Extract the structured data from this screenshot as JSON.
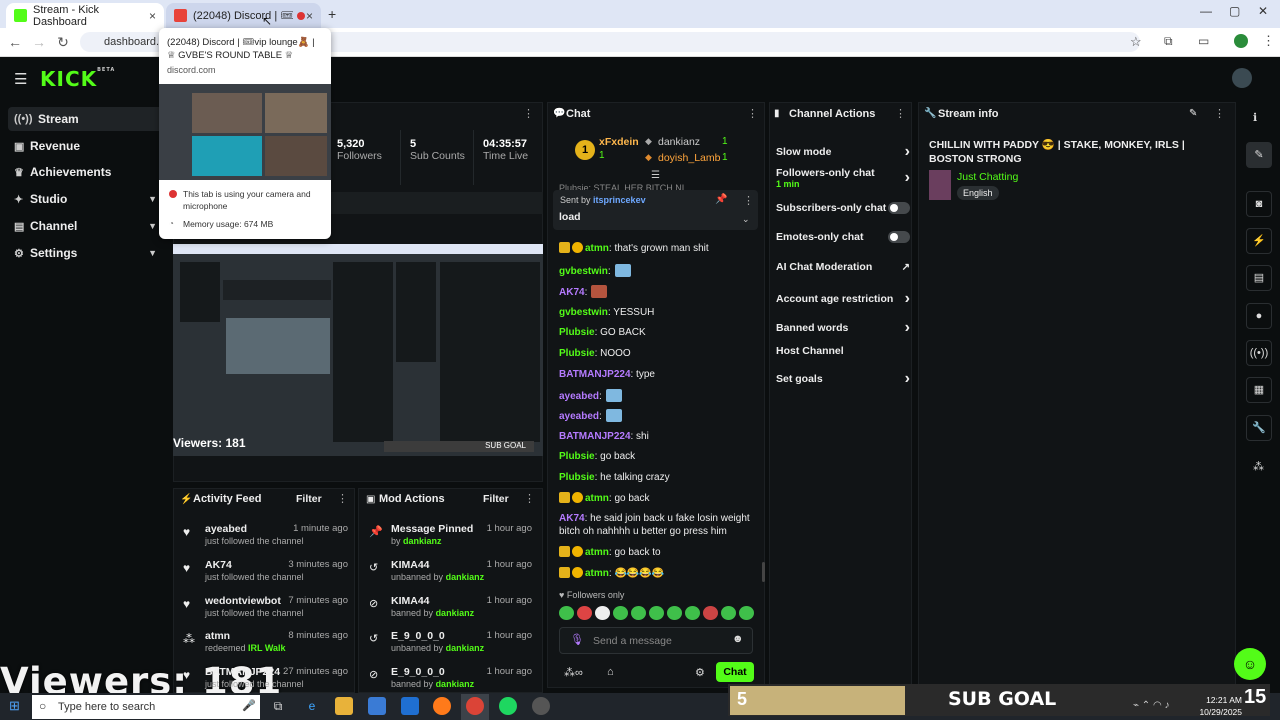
{
  "browser": {
    "tabs": [
      {
        "label": "Stream - Kick Dashboard",
        "close": "×"
      },
      {
        "label": "(22048) Discord | 🎟vip lou",
        "close": "×"
      }
    ],
    "new_tab": "+",
    "url": "dashboard.kick.com",
    "window_controls": [
      "—",
      "▢",
      "✕"
    ]
  },
  "tooltip": {
    "title": "(22048) Discord | 🎟vip lounge🧸 | ♕ GVBE'S ROUND TABLE ♕",
    "domain": "discord.com",
    "camera_note": "This tab is using your camera and microphone",
    "memory": "Memory usage: 674 MB"
  },
  "sidebar": {
    "items": [
      {
        "label": "Stream",
        "icon": "stream-icon"
      },
      {
        "label": "Revenue",
        "icon": "revenue-icon"
      },
      {
        "label": "Achievements",
        "icon": "trophy-icon"
      },
      {
        "label": "Studio",
        "icon": "studio-icon"
      },
      {
        "label": "Channel",
        "icon": "channel-icon"
      },
      {
        "label": "Settings",
        "icon": "gear-icon"
      }
    ]
  },
  "stats": [
    {
      "value": "5,320",
      "label": "Followers"
    },
    {
      "value": "5",
      "label": "Sub Counts"
    },
    {
      "value": "04:35:57",
      "label": "Time Live"
    }
  ],
  "video": {
    "viewers": "Viewers: 181",
    "sub_goal_small": "SUB GOAL"
  },
  "overlay": {
    "viewers": "Viewers: 181",
    "sub_goal_count": "5",
    "sub_goal_label": "SUB GOAL"
  },
  "chat": {
    "title": "Chat",
    "gifters": [
      {
        "rank": "1",
        "name": "xFxdein",
        "count": "1"
      },
      {
        "rank": "",
        "name": "dankianz",
        "count": "1"
      },
      {
        "rank": "",
        "name": "doyish_Lamb",
        "count": "1"
      }
    ],
    "pinned_behind": "Plubsie: STEAL HER BITCH NI",
    "pinned": {
      "sent_by_label": "Sent by",
      "sent_by": "itsprincekev",
      "text": "load"
    },
    "messages": [
      {
        "user": "atmn",
        "color": "g",
        "text": ": that's grown man shit",
        "badges": 2
      },
      {
        "user": "gvbestwin",
        "color": "g",
        "text": ":",
        "emote": true
      },
      {
        "user": "AK74",
        "color": "p",
        "text": ":",
        "emote": true
      },
      {
        "user": "gvbestwin",
        "color": "g",
        "text": ": YESSUH"
      },
      {
        "user": "Plubsie",
        "color": "g",
        "text": ": GO BACK"
      },
      {
        "user": "Plubsie",
        "color": "g",
        "text": ": NOOO"
      },
      {
        "user": "BATMANJP224",
        "color": "p",
        "text": ": type"
      },
      {
        "user": "ayeabed",
        "color": "p",
        "text": ":",
        "emote": true
      },
      {
        "user": "ayeabed",
        "color": "p",
        "text": ":",
        "emote": true
      },
      {
        "user": "BATMANJP224",
        "color": "p",
        "text": ": shi"
      },
      {
        "user": "Plubsie",
        "color": "g",
        "text": ": go back"
      },
      {
        "user": "Plubsie",
        "color": "g",
        "text": ": he talking crazy"
      },
      {
        "user": "atmn",
        "color": "g",
        "text": ": go back",
        "badges": 2
      },
      {
        "user": "AK74",
        "color": "p",
        "text": ": he said join back u fake losin weight bitch oh nahhhh u better go press him"
      },
      {
        "user": "atmn",
        "color": "g",
        "text": ": go back to",
        "badges": 2
      },
      {
        "user": "atmn",
        "color": "g",
        "text": ": 😂😂😂😂",
        "badges": 2
      }
    ],
    "followers_only": "Followers only",
    "placeholder": "Send a message",
    "send_label": "Chat"
  },
  "channel_actions": {
    "title": "Channel Actions",
    "items": [
      {
        "label": "Slow mode"
      },
      {
        "label": "Followers-only chat",
        "sub": "1 min"
      },
      {
        "label": "Subscribers-only chat"
      },
      {
        "label": "Emotes-only chat"
      },
      {
        "label": "AI Chat Moderation"
      },
      {
        "label": "Account age restriction"
      },
      {
        "label": "Banned words"
      },
      {
        "label": "Host Channel"
      },
      {
        "label": "Set goals"
      }
    ]
  },
  "stream_info": {
    "title": "Stream info",
    "stream_title": "CHILLIN WITH PADDY 😎 | STAKE, MONKEY, IRLS | BOSTON STRONG",
    "category": "Just Chatting",
    "language": "English"
  },
  "activity_feed": {
    "title": "Activity Feed",
    "filter": "Filter",
    "items": [
      {
        "user": "ayeabed",
        "time": "1 minute ago",
        "desc": "just followed the channel",
        "icon": "heart-icon"
      },
      {
        "user": "AK74",
        "time": "3 minutes ago",
        "desc": "just followed the channel",
        "icon": "heart-icon"
      },
      {
        "user": "wedontviewbot",
        "time": "7 minutes ago",
        "desc": "just followed the channel",
        "icon": "heart-icon"
      },
      {
        "user": "atmn",
        "time": "8 minutes ago",
        "desc": "redeemed",
        "extra": "IRL Walk",
        "icon": "redeem-icon"
      },
      {
        "user": "BATMANJP224",
        "time": "27 minutes ago",
        "desc": "just followed the channel",
        "icon": "heart-icon"
      }
    ]
  },
  "mod_actions": {
    "title": "Mod Actions",
    "filter": "Filter",
    "items": [
      {
        "title": "Message Pinned",
        "time": "1 hour ago",
        "desc": "by",
        "by": "dankianz",
        "icon": "pin-icon"
      },
      {
        "title": "KIMA44",
        "time": "1 hour ago",
        "desc": "unbanned by",
        "by": "dankianz",
        "icon": "unban-icon"
      },
      {
        "title": "KIMA44",
        "time": "1 hour ago",
        "desc": "banned by",
        "by": "dankianz",
        "icon": "ban-icon"
      },
      {
        "title": "E_9_0_0_0",
        "time": "1 hour ago",
        "desc": "unbanned by",
        "by": "dankianz",
        "icon": "unban-icon"
      },
      {
        "title": "E_9_0_0_0",
        "time": "1 hour ago",
        "desc": "banned by",
        "by": "dankianz",
        "icon": "ban-icon"
      }
    ]
  },
  "taskbar": {
    "search_placeholder": "Type here to search",
    "time": "12:21 AM",
    "date": "10/29/2025"
  },
  "colors": {
    "kick_green": "#53fc18",
    "panel": "#111416",
    "purple": "#b57bff"
  }
}
